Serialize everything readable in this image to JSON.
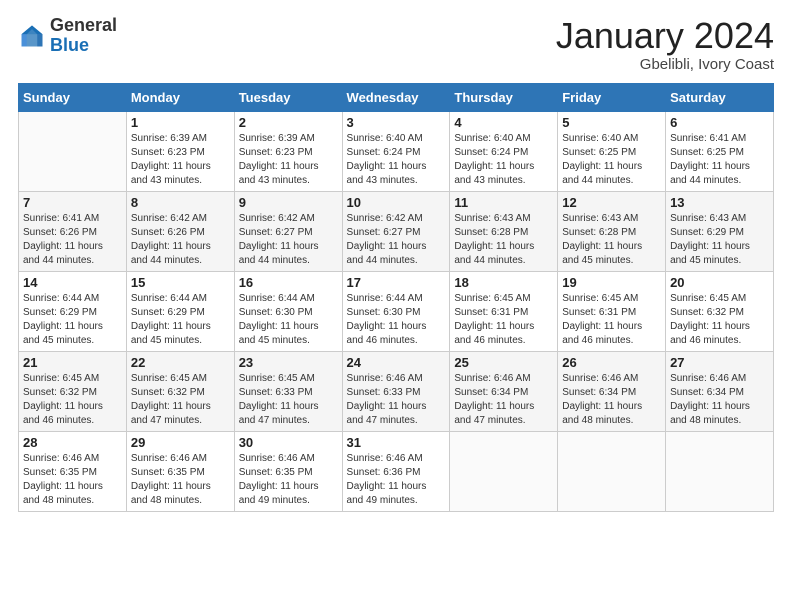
{
  "header": {
    "logo": {
      "general": "General",
      "blue": "Blue"
    },
    "title": "January 2024",
    "subtitle": "Gbelibli, Ivory Coast"
  },
  "weekdays": [
    "Sunday",
    "Monday",
    "Tuesday",
    "Wednesday",
    "Thursday",
    "Friday",
    "Saturday"
  ],
  "weeks": [
    [
      {
        "day": "",
        "sunrise": "",
        "sunset": "",
        "daylight": ""
      },
      {
        "day": "1",
        "sunrise": "Sunrise: 6:39 AM",
        "sunset": "Sunset: 6:23 PM",
        "daylight": "Daylight: 11 hours and 43 minutes."
      },
      {
        "day": "2",
        "sunrise": "Sunrise: 6:39 AM",
        "sunset": "Sunset: 6:23 PM",
        "daylight": "Daylight: 11 hours and 43 minutes."
      },
      {
        "day": "3",
        "sunrise": "Sunrise: 6:40 AM",
        "sunset": "Sunset: 6:24 PM",
        "daylight": "Daylight: 11 hours and 43 minutes."
      },
      {
        "day": "4",
        "sunrise": "Sunrise: 6:40 AM",
        "sunset": "Sunset: 6:24 PM",
        "daylight": "Daylight: 11 hours and 43 minutes."
      },
      {
        "day": "5",
        "sunrise": "Sunrise: 6:40 AM",
        "sunset": "Sunset: 6:25 PM",
        "daylight": "Daylight: 11 hours and 44 minutes."
      },
      {
        "day": "6",
        "sunrise": "Sunrise: 6:41 AM",
        "sunset": "Sunset: 6:25 PM",
        "daylight": "Daylight: 11 hours and 44 minutes."
      }
    ],
    [
      {
        "day": "7",
        "sunrise": "Sunrise: 6:41 AM",
        "sunset": "Sunset: 6:26 PM",
        "daylight": "Daylight: 11 hours and 44 minutes."
      },
      {
        "day": "8",
        "sunrise": "Sunrise: 6:42 AM",
        "sunset": "Sunset: 6:26 PM",
        "daylight": "Daylight: 11 hours and 44 minutes."
      },
      {
        "day": "9",
        "sunrise": "Sunrise: 6:42 AM",
        "sunset": "Sunset: 6:27 PM",
        "daylight": "Daylight: 11 hours and 44 minutes."
      },
      {
        "day": "10",
        "sunrise": "Sunrise: 6:42 AM",
        "sunset": "Sunset: 6:27 PM",
        "daylight": "Daylight: 11 hours and 44 minutes."
      },
      {
        "day": "11",
        "sunrise": "Sunrise: 6:43 AM",
        "sunset": "Sunset: 6:28 PM",
        "daylight": "Daylight: 11 hours and 44 minutes."
      },
      {
        "day": "12",
        "sunrise": "Sunrise: 6:43 AM",
        "sunset": "Sunset: 6:28 PM",
        "daylight": "Daylight: 11 hours and 45 minutes."
      },
      {
        "day": "13",
        "sunrise": "Sunrise: 6:43 AM",
        "sunset": "Sunset: 6:29 PM",
        "daylight": "Daylight: 11 hours and 45 minutes."
      }
    ],
    [
      {
        "day": "14",
        "sunrise": "Sunrise: 6:44 AM",
        "sunset": "Sunset: 6:29 PM",
        "daylight": "Daylight: 11 hours and 45 minutes."
      },
      {
        "day": "15",
        "sunrise": "Sunrise: 6:44 AM",
        "sunset": "Sunset: 6:29 PM",
        "daylight": "Daylight: 11 hours and 45 minutes."
      },
      {
        "day": "16",
        "sunrise": "Sunrise: 6:44 AM",
        "sunset": "Sunset: 6:30 PM",
        "daylight": "Daylight: 11 hours and 45 minutes."
      },
      {
        "day": "17",
        "sunrise": "Sunrise: 6:44 AM",
        "sunset": "Sunset: 6:30 PM",
        "daylight": "Daylight: 11 hours and 46 minutes."
      },
      {
        "day": "18",
        "sunrise": "Sunrise: 6:45 AM",
        "sunset": "Sunset: 6:31 PM",
        "daylight": "Daylight: 11 hours and 46 minutes."
      },
      {
        "day": "19",
        "sunrise": "Sunrise: 6:45 AM",
        "sunset": "Sunset: 6:31 PM",
        "daylight": "Daylight: 11 hours and 46 minutes."
      },
      {
        "day": "20",
        "sunrise": "Sunrise: 6:45 AM",
        "sunset": "Sunset: 6:32 PM",
        "daylight": "Daylight: 11 hours and 46 minutes."
      }
    ],
    [
      {
        "day": "21",
        "sunrise": "Sunrise: 6:45 AM",
        "sunset": "Sunset: 6:32 PM",
        "daylight": "Daylight: 11 hours and 46 minutes."
      },
      {
        "day": "22",
        "sunrise": "Sunrise: 6:45 AM",
        "sunset": "Sunset: 6:32 PM",
        "daylight": "Daylight: 11 hours and 47 minutes."
      },
      {
        "day": "23",
        "sunrise": "Sunrise: 6:45 AM",
        "sunset": "Sunset: 6:33 PM",
        "daylight": "Daylight: 11 hours and 47 minutes."
      },
      {
        "day": "24",
        "sunrise": "Sunrise: 6:46 AM",
        "sunset": "Sunset: 6:33 PM",
        "daylight": "Daylight: 11 hours and 47 minutes."
      },
      {
        "day": "25",
        "sunrise": "Sunrise: 6:46 AM",
        "sunset": "Sunset: 6:34 PM",
        "daylight": "Daylight: 11 hours and 47 minutes."
      },
      {
        "day": "26",
        "sunrise": "Sunrise: 6:46 AM",
        "sunset": "Sunset: 6:34 PM",
        "daylight": "Daylight: 11 hours and 48 minutes."
      },
      {
        "day": "27",
        "sunrise": "Sunrise: 6:46 AM",
        "sunset": "Sunset: 6:34 PM",
        "daylight": "Daylight: 11 hours and 48 minutes."
      }
    ],
    [
      {
        "day": "28",
        "sunrise": "Sunrise: 6:46 AM",
        "sunset": "Sunset: 6:35 PM",
        "daylight": "Daylight: 11 hours and 48 minutes."
      },
      {
        "day": "29",
        "sunrise": "Sunrise: 6:46 AM",
        "sunset": "Sunset: 6:35 PM",
        "daylight": "Daylight: 11 hours and 48 minutes."
      },
      {
        "day": "30",
        "sunrise": "Sunrise: 6:46 AM",
        "sunset": "Sunset: 6:35 PM",
        "daylight": "Daylight: 11 hours and 49 minutes."
      },
      {
        "day": "31",
        "sunrise": "Sunrise: 6:46 AM",
        "sunset": "Sunset: 6:36 PM",
        "daylight": "Daylight: 11 hours and 49 minutes."
      },
      {
        "day": "",
        "sunrise": "",
        "sunset": "",
        "daylight": ""
      },
      {
        "day": "",
        "sunrise": "",
        "sunset": "",
        "daylight": ""
      },
      {
        "day": "",
        "sunrise": "",
        "sunset": "",
        "daylight": ""
      }
    ]
  ]
}
